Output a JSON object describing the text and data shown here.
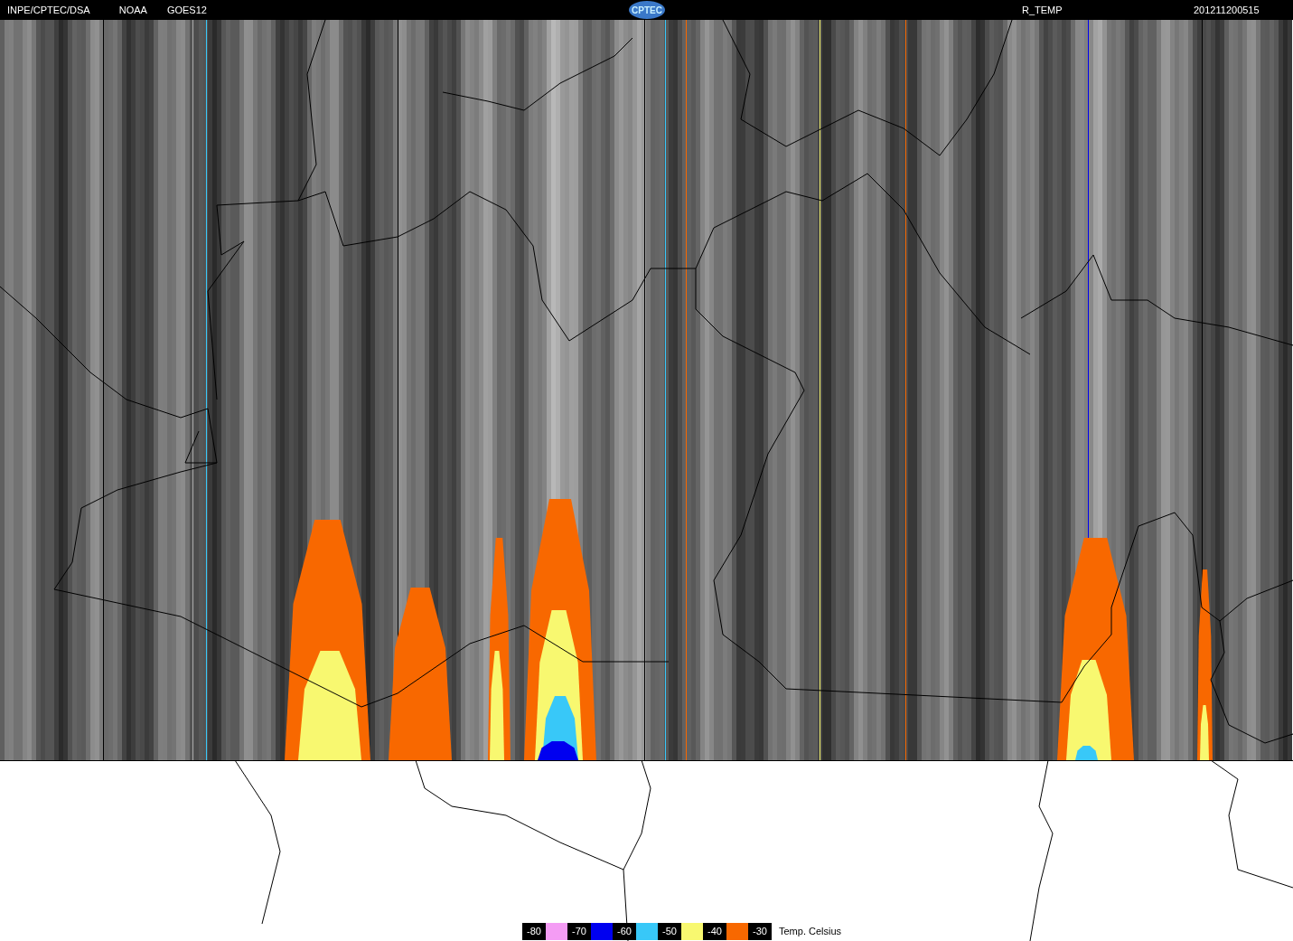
{
  "header": {
    "source": "INPE/CPTEC/DSA",
    "agency": "NOAA",
    "satellite": "GOES12",
    "logo": "CPTEC",
    "product": "R_TEMP",
    "timestamp": "201211200515"
  },
  "legend": {
    "levels": [
      "-80",
      "-70",
      "-60",
      "-50",
      "-40",
      "-30"
    ],
    "swatches": [
      {
        "color": "#f49cf4"
      },
      {
        "color": "#0000f0"
      },
      {
        "color": "#38c8f8"
      },
      {
        "color": "#f8f870"
      },
      {
        "color": "#f86800"
      }
    ],
    "unit": "Temp. Celsius"
  }
}
